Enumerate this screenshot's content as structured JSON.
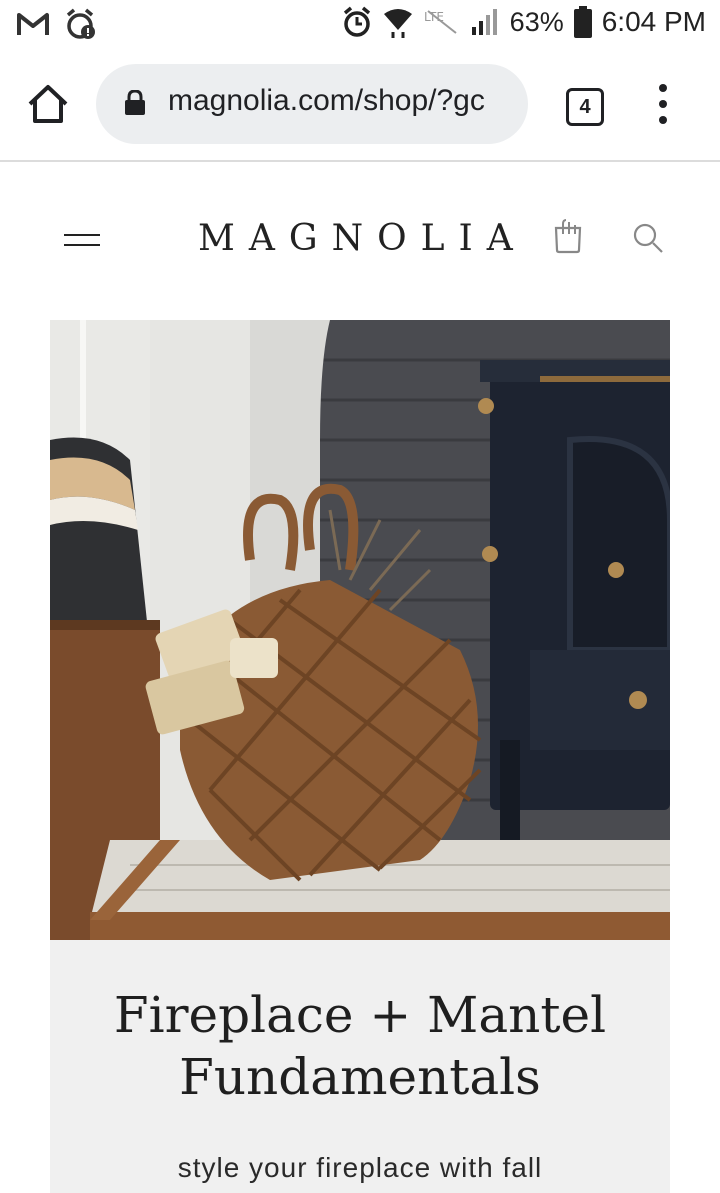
{
  "status_bar": {
    "battery_percent": "63%",
    "time": "6:04 PM",
    "icons": [
      "gmail-icon",
      "alarm-icon",
      "alarm-icon",
      "wifi-icon",
      "lte-icon",
      "signal-icon",
      "battery-icon"
    ]
  },
  "browser": {
    "url": "magnolia.com/shop/?gc",
    "tab_count": "4",
    "icons": [
      "home-icon",
      "lock-icon",
      "more-vert-icon"
    ]
  },
  "site": {
    "logo": "MAGNOLIA",
    "icons": [
      "hamburger-menu-icon",
      "cart-icon",
      "search-icon"
    ]
  },
  "hero": {
    "image_subject": "woven basket with firewood beside black wood stove"
  },
  "card": {
    "title_line1": "Fireplace + Mantel",
    "title_line2": "Fundamentals",
    "subtitle": "style your fireplace with fall"
  },
  "colors": {
    "card_background": "#f0f0f0",
    "url_pill": "#eceef0",
    "text": "#202124"
  }
}
